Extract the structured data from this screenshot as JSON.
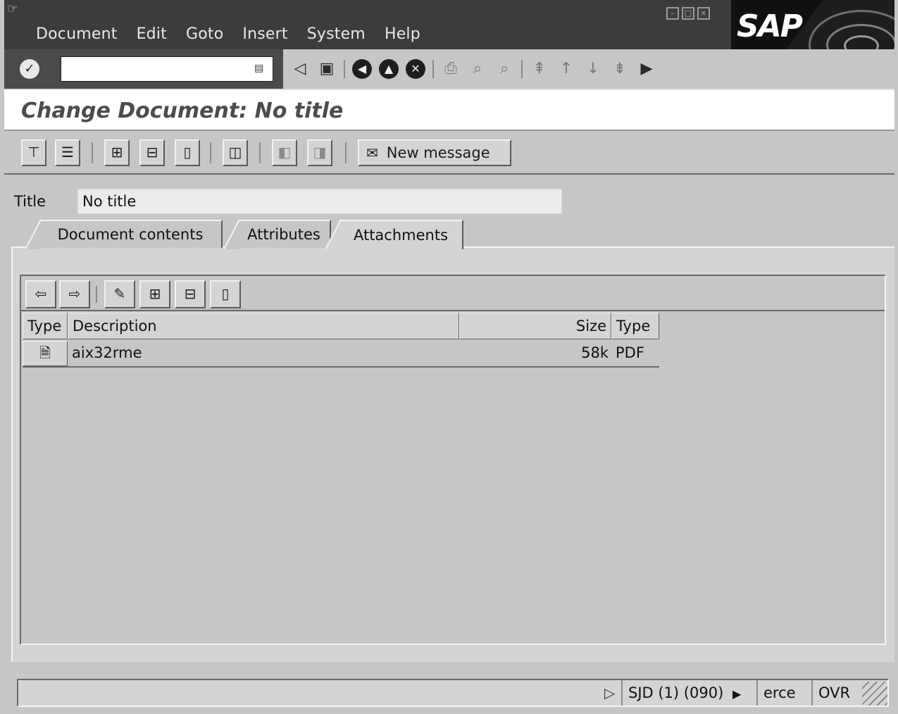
{
  "menubar": {
    "items": [
      "Document",
      "Edit",
      "Goto",
      "Insert",
      "System",
      "Help"
    ],
    "logo_text": "SAP"
  },
  "standard_toolbar": {
    "command_field_value": "",
    "icons": [
      "enter-icon",
      "back-icon",
      "save-icon",
      "back-nav-icon",
      "exit-icon",
      "cancel-icon",
      "print-icon",
      "find-icon",
      "find-next-icon",
      "first-page-icon",
      "previous-page-icon",
      "next-page-icon",
      "last-page-icon",
      "customize-layout-icon"
    ]
  },
  "title_bar": {
    "title": "Change Document: No title"
  },
  "app_toolbar": {
    "new_message_label": "New message"
  },
  "form": {
    "title_label": "Title",
    "title_value": "No title"
  },
  "tabs": [
    {
      "label": "Document contents",
      "active": false
    },
    {
      "label": "Attributes",
      "active": false
    },
    {
      "label": "Attachments",
      "active": true
    }
  ],
  "attachments": {
    "columns": [
      "Type",
      "Description",
      "Size",
      "Type"
    ],
    "rows": [
      {
        "type_icon": "pdf-document-icon",
        "description": "aix32rme",
        "size": "58k",
        "type": "PDF"
      }
    ]
  },
  "status_bar": {
    "system": "SJD (1) (090)",
    "server": "erce",
    "mode": "OVR"
  },
  "colors": {
    "menubar_bg": "#3c3c3c",
    "panel_bg": "#c6c6c6",
    "title_text": "#4c4c4c"
  }
}
